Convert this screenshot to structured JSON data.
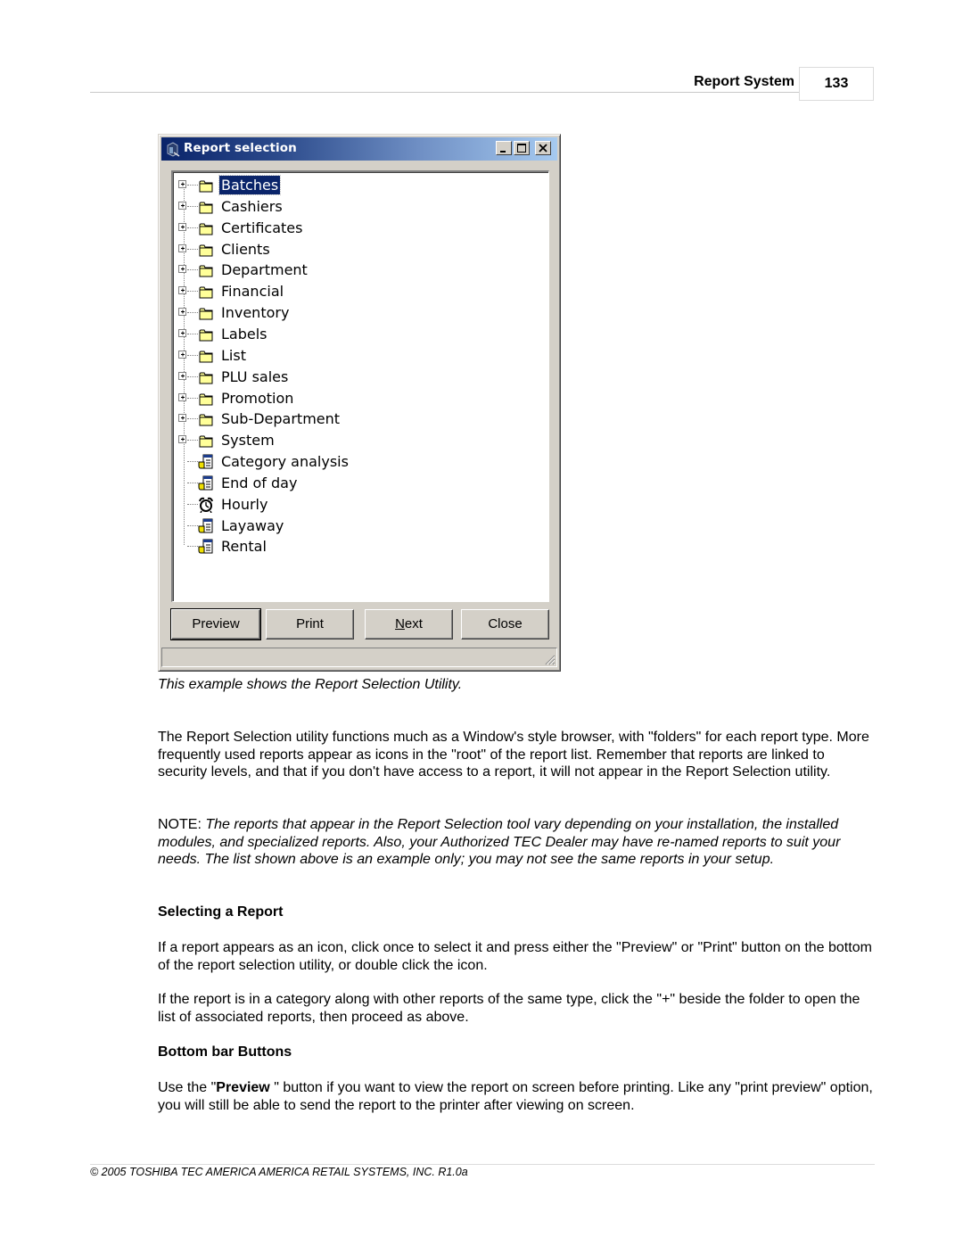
{
  "header": {
    "section_title": "Report System",
    "page_number": "133"
  },
  "window": {
    "title": "Report selection",
    "title_buttons": [
      "minimize",
      "maximize",
      "close"
    ],
    "tree": {
      "selected_index": 0,
      "items": [
        {
          "label": "Batches",
          "type": "folder",
          "icon": "folder-icon",
          "expandable": true
        },
        {
          "label": "Cashiers",
          "type": "folder",
          "icon": "folder-icon",
          "expandable": true
        },
        {
          "label": "Certificates",
          "type": "folder",
          "icon": "folder-icon",
          "expandable": true
        },
        {
          "label": "Clients",
          "type": "folder",
          "icon": "folder-icon",
          "expandable": true
        },
        {
          "label": "Department",
          "type": "folder",
          "icon": "folder-icon",
          "expandable": true
        },
        {
          "label": "Financial",
          "type": "folder",
          "icon": "folder-icon",
          "expandable": true
        },
        {
          "label": "Inventory",
          "type": "folder",
          "icon": "folder-icon",
          "expandable": true
        },
        {
          "label": "Labels",
          "type": "folder",
          "icon": "folder-icon",
          "expandable": true
        },
        {
          "label": "List",
          "type": "folder",
          "icon": "folder-icon",
          "expandable": true
        },
        {
          "label": "PLU sales",
          "type": "folder",
          "icon": "folder-icon",
          "expandable": true
        },
        {
          "label": "Promotion",
          "type": "folder",
          "icon": "folder-icon",
          "expandable": true
        },
        {
          "label": "Sub-Department",
          "type": "folder",
          "icon": "folder-icon",
          "expandable": true
        },
        {
          "label": "System",
          "type": "folder",
          "icon": "folder-icon",
          "expandable": true
        },
        {
          "label": "Category analysis",
          "type": "report",
          "icon": "report-icon",
          "expandable": false
        },
        {
          "label": "End of day",
          "type": "report",
          "icon": "report-icon",
          "expandable": false
        },
        {
          "label": "Hourly",
          "type": "report",
          "icon": "alarm-clock-icon",
          "expandable": false
        },
        {
          "label": "Layaway",
          "type": "report",
          "icon": "report-icon",
          "expandable": false
        },
        {
          "label": "Rental",
          "type": "report",
          "icon": "report-icon",
          "expandable": false
        }
      ]
    },
    "buttons": {
      "preview": "Preview",
      "print": "Print",
      "next_mnemonic": "N",
      "next_rest": "ext",
      "close": "Close"
    },
    "colors": {
      "titlebar_start": "#0a246a",
      "titlebar_end": "#a6caf0",
      "face": "#d4d0c8",
      "selection": "#0a246a"
    }
  },
  "caption": "This example shows the Report Selection Utility.",
  "body": {
    "p1": " The Report Selection utility functions much as a Window's style browser, with \"folders\" for each report type. More frequently used reports appear as icons in the \"root\" of the report list. Remember that reports are linked to security levels, and that if you don't have access to a report, it will not appear in the Report Selection utility.",
    "note_label": "NOTE: ",
    "note_text": "The reports that appear in the Report Selection tool vary depending on your installation, the installed modules, and specialized reports. Also, your Authorized TEC Dealer may have re-named reports to suit your needs. The list shown above is an example only; you may not see the same reports in your setup.",
    "heading1": "Selecting a Report",
    "p3": " If a report appears as an icon, click once to select it and press either the \"Preview\" or \"Print\" button on the bottom of the report selection utility, or double click the icon.",
    "p4": " If the report is in a category along with other reports of the same type, click the \"+\" beside the folder to open the list of associated reports, then proceed as above.",
    "heading2": "Bottom bar Buttons",
    "p5_a": " Use the \"",
    "p5_bold": "Preview",
    "p5_b": " \" button if you want to view the report on screen before printing. Like any \"print preview\" option, you will still be able to send the report to the printer after viewing on screen."
  },
  "footer": "© 2005 TOSHIBA TEC AMERICA AMERICA RETAIL SYSTEMS, INC.   R1.0a"
}
